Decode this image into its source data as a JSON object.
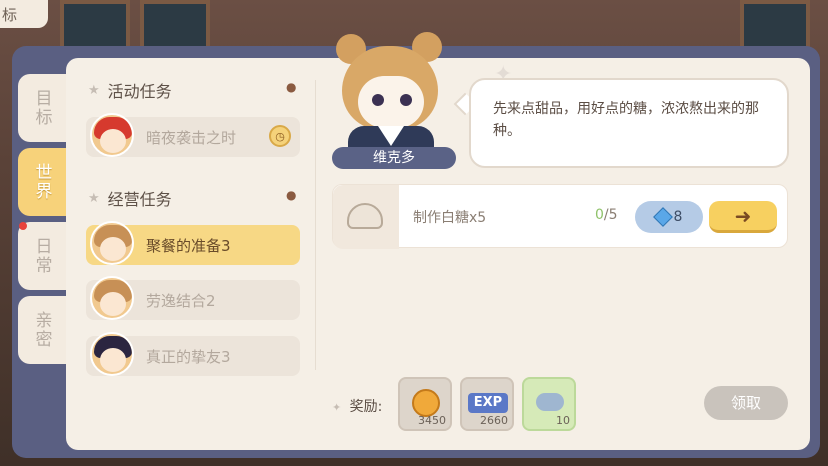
{
  "top_tab": {
    "label": "标"
  },
  "side_tabs": [
    {
      "label": "目标",
      "active": false
    },
    {
      "label": "世界",
      "active": true
    },
    {
      "label": "日常",
      "active": false,
      "badge": true
    },
    {
      "label": "亲密",
      "active": false
    }
  ],
  "sections": [
    {
      "title": "活动任务",
      "tasks": [
        {
          "label": "暗夜袭击之时",
          "active": false,
          "icon": "clock-icon"
        }
      ]
    },
    {
      "title": "经营任务",
      "tasks": [
        {
          "label": "聚餐的准备3",
          "active": true
        },
        {
          "label": "劳逸结合2",
          "active": false
        },
        {
          "label": "真正的挚友3",
          "active": false
        }
      ]
    }
  ],
  "npc": {
    "name": "维克多",
    "dialog": "先来点甜品，用好点的糖，浓浓熬出来的那种。"
  },
  "goal": {
    "text": "制作白糖x5",
    "progress_current": "0",
    "progress_total": "/5",
    "gem_cost": "8",
    "go_icon": "arrow-right-icon"
  },
  "rewards": {
    "label": "奖励:",
    "items": [
      {
        "icon": "coin-icon",
        "count": "3450"
      },
      {
        "icon": "exp-icon",
        "icon_text": "EXP",
        "count": "2660"
      },
      {
        "icon": "cloud-icon",
        "count": "10"
      }
    ],
    "claim_label": "领取"
  },
  "colors": {
    "active_tab": "#f7d27a",
    "frame": "#5a5f82",
    "panel": "#f5efe6",
    "claim_disabled": "#c9c3bc"
  }
}
